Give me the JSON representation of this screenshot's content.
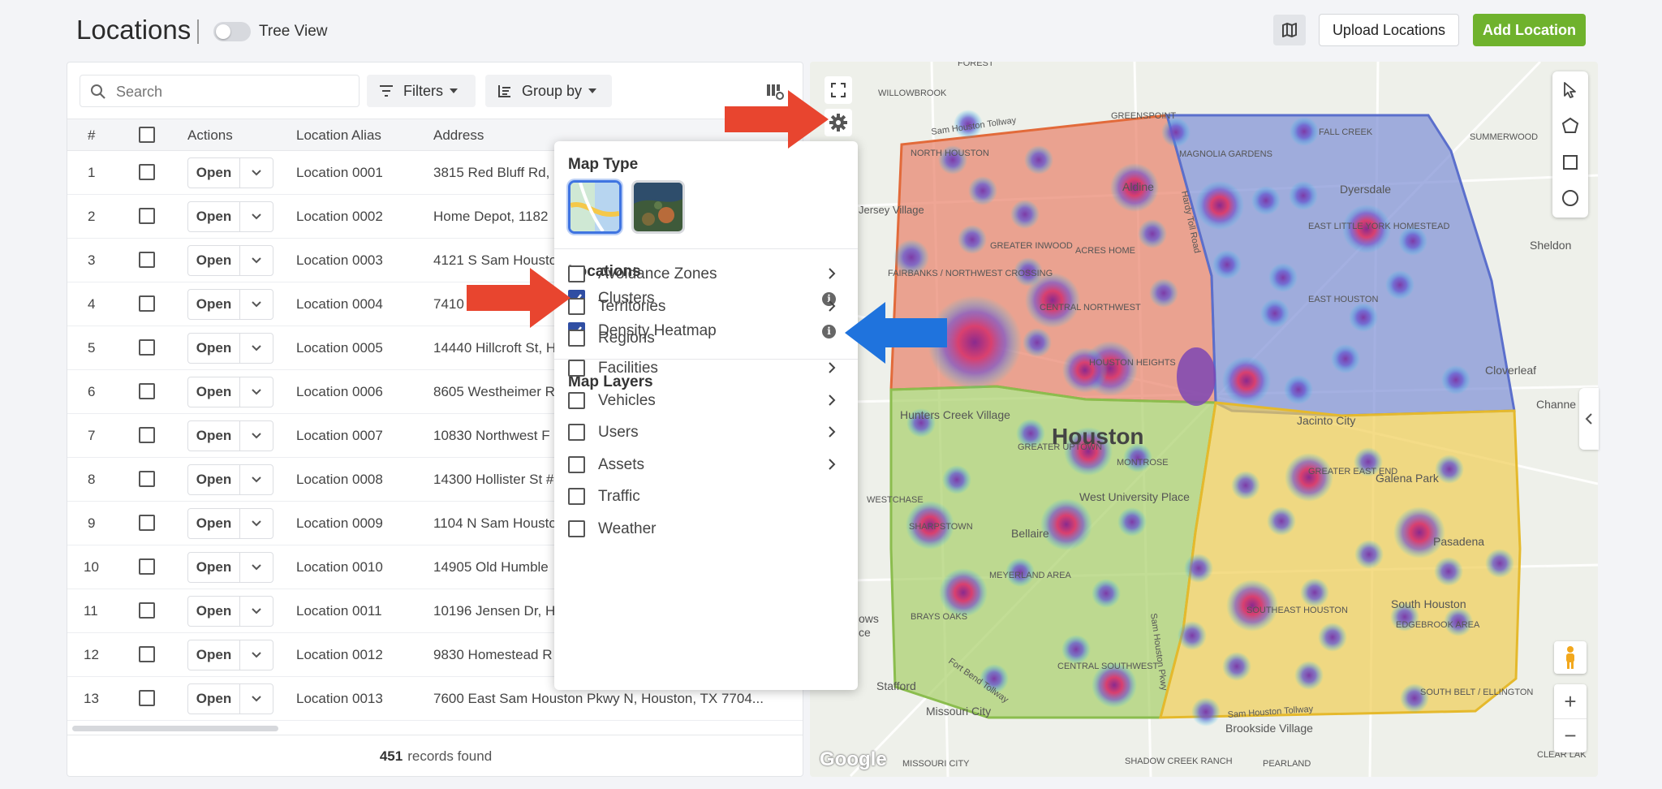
{
  "header": {
    "title": "Locations",
    "tree_view_label": "Tree View",
    "upload_label": "Upload Locations",
    "add_label": "Add Location"
  },
  "toolbar": {
    "search_placeholder": "Search",
    "filters_label": "Filters",
    "group_by_label": "Group by"
  },
  "table": {
    "columns": [
      "#",
      "",
      "Actions",
      "Location Alias",
      "Address"
    ],
    "open_label": "Open",
    "rows": [
      {
        "num": "1",
        "alias": "Location 0001",
        "address": "3815 Red Bluff Rd,"
      },
      {
        "num": "2",
        "alias": "Location 0002",
        "address": "Home Depot, 1182"
      },
      {
        "num": "3",
        "alias": "Location 0003",
        "address": "4121 S Sam Housto"
      },
      {
        "num": "4",
        "alias": "Location 0004",
        "address": "7410"
      },
      {
        "num": "5",
        "alias": "Location 0005",
        "address": "14440 Hillcroft St, H"
      },
      {
        "num": "6",
        "alias": "Location 0006",
        "address": "8605 Westheimer R"
      },
      {
        "num": "7",
        "alias": "Location 0007",
        "address": "10830 Northwest F"
      },
      {
        "num": "8",
        "alias": "Location 0008",
        "address": "14300 Hollister St #"
      },
      {
        "num": "9",
        "alias": "Location 0009",
        "address": "1104 N Sam Housto"
      },
      {
        "num": "10",
        "alias": "Location 0010",
        "address": "14905 Old Humble"
      },
      {
        "num": "11",
        "alias": "Location 0011",
        "address": "10196 Jensen Dr, H"
      },
      {
        "num": "12",
        "alias": "Location 0012",
        "address": "9830 Homestead R"
      },
      {
        "num": "13",
        "alias": "Location 0013",
        "address": "7600 East Sam Houston Pkwy N, Houston, TX 7704..."
      }
    ]
  },
  "footer": {
    "count": "451",
    "text": "records found"
  },
  "popup": {
    "map_type_heading": "Map Type",
    "map_types": [
      "roadmap",
      "satellite"
    ],
    "locations_heading": "Locations",
    "location_options": [
      {
        "label": "Clusters",
        "checked": true
      },
      {
        "label": "Density Heatmap",
        "checked": true
      }
    ],
    "layers_heading": "Map Layers",
    "layers": [
      {
        "label": "Avoidance Zones",
        "has_submenu": true
      },
      {
        "label": "Territories",
        "has_submenu": true
      },
      {
        "label": "Regions",
        "has_submenu": false
      },
      {
        "label": "Facilities",
        "has_submenu": true
      },
      {
        "label": "Vehicles",
        "has_submenu": true
      },
      {
        "label": "Users",
        "has_submenu": true
      },
      {
        "label": "Assets",
        "has_submenu": true
      },
      {
        "label": "Traffic",
        "has_submenu": false
      },
      {
        "label": "Weather",
        "has_submenu": false
      }
    ]
  },
  "map": {
    "city_label": "Houston",
    "labels": [
      "FOREST",
      "WILLOWBROOK",
      "Sam Houston Tollway",
      "NORTH HOUSTON",
      "GREENSPOINT",
      "FALL CREEK",
      "SUMMERWOOD",
      "MAGNOLIA GARDENS",
      "Jersey Village",
      "Aldine",
      "Dyersdale",
      "GREATER INWOOD",
      "ACRES HOME",
      "EAST LITTLE YORK HOMESTEAD",
      "Sheldon",
      "FAIRBANKS / NORTHWEST CROSSING",
      "CENTRAL NORTHWEST",
      "EAST HOUSTON",
      "Cloverleaf",
      "HOUSTON HEIGHTS",
      "Hunters Creek Village",
      "GREATER UPTOWN",
      "Jacinto City",
      "Channe",
      "MONTROSE",
      "Galena Park",
      "WESTCHASE",
      "West University Place",
      "GREATER EAST END",
      "SHARPSTOWN",
      "Bellaire",
      "Pasadena",
      "MEYERLAND AREA",
      "BRAYS OAKS",
      "SOUTHEAST HOUSTON",
      "South Houston",
      "EDGEBROOK AREA",
      "ows",
      "ce",
      "CENTRAL SOUTHWEST",
      "SOUTH BELT / ELLINGTON",
      "Stafford",
      "Missouri City",
      "Brookside Village",
      "SHADOW CREEK RANCH",
      "PEARLAND",
      "MISSOURI CITY",
      "Google",
      "Sam Houston Tollway",
      "CLEAR LAK",
      "Fort Bend Tollway",
      "Hardy Toll Road",
      "Sam Houston Pkwy"
    ],
    "colors": {
      "territory_red": "#e8806a",
      "territory_blue": "#7d8fd6",
      "territory_green": "#a8cf6a",
      "territory_yellow": "#f0cd55",
      "heat_core": "#9b2f86",
      "heat_mid": "#e23e6b",
      "heat_edge": "#2fc8e8"
    }
  },
  "colors": {
    "accent_green": "#6fb22d",
    "checkbox_blue": "#2f4ea3",
    "annotation_red": "#e8452f",
    "annotation_blue": "#1f73dd"
  }
}
